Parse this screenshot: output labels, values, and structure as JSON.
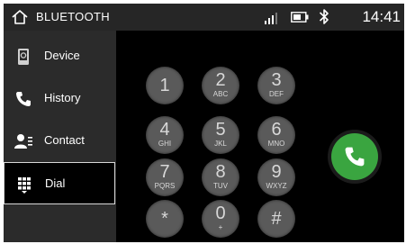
{
  "status_bar": {
    "title": "BLUETOOTH",
    "time": "14:41",
    "icons": [
      "home-icon",
      "signal-icon",
      "battery-icon",
      "bluetooth-icon"
    ]
  },
  "sidebar": {
    "items": [
      {
        "label": "Device",
        "icon": "phone-device-icon",
        "active": false
      },
      {
        "label": "History",
        "icon": "phone-history-icon",
        "active": false
      },
      {
        "label": "Contact",
        "icon": "contact-icon",
        "active": false
      },
      {
        "label": "Dial",
        "icon": "dialpad-icon",
        "active": true
      }
    ]
  },
  "keypad": {
    "keys": [
      {
        "digit": "1",
        "letters": ""
      },
      {
        "digit": "2",
        "letters": "ABC"
      },
      {
        "digit": "3",
        "letters": "DEF"
      },
      {
        "digit": "4",
        "letters": "GHI"
      },
      {
        "digit": "5",
        "letters": "JKL"
      },
      {
        "digit": "6",
        "letters": "MNO"
      },
      {
        "digit": "7",
        "letters": "PQRS"
      },
      {
        "digit": "8",
        "letters": "TUV"
      },
      {
        "digit": "9",
        "letters": "WXYZ"
      },
      {
        "digit": "*",
        "letters": ""
      },
      {
        "digit": "0",
        "letters": "+"
      },
      {
        "digit": "#",
        "letters": ""
      }
    ]
  },
  "call_button": {
    "icon": "phone-call-icon",
    "color": "#3aa540"
  },
  "colors": {
    "background": "#000000",
    "sidebar": "#2b2b2b",
    "key": "#5a5a5a",
    "status_bar": "#262626"
  }
}
